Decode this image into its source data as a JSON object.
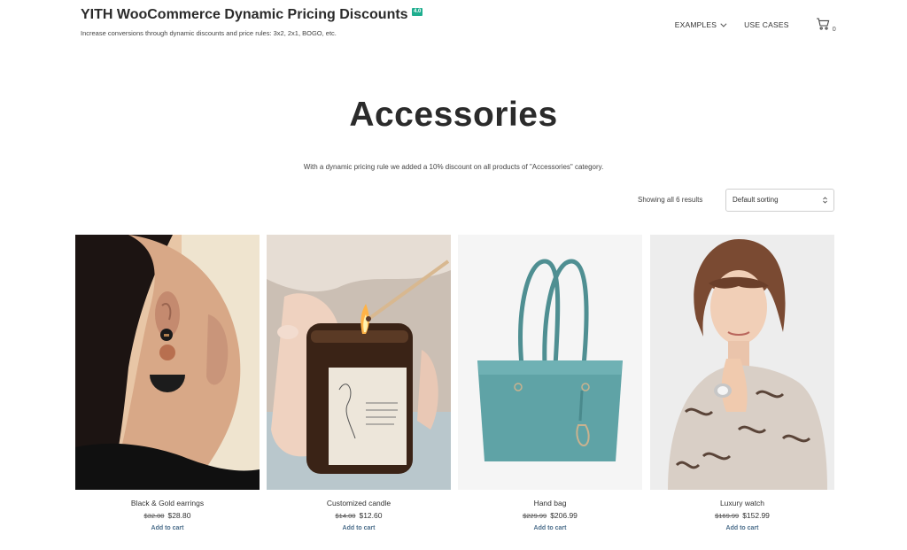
{
  "site": {
    "title": "YITH WooCommerce Dynamic Pricing Discounts",
    "version_badge": "4.0",
    "tagline": "Increase conversions through dynamic discounts and price rules: 3x2, 2x1, BOGO, etc."
  },
  "nav": {
    "items": [
      {
        "label": "EXAMPLES",
        "has_dropdown": true
      },
      {
        "label": "USE CASES",
        "has_dropdown": false
      }
    ],
    "cart_count": "0"
  },
  "page": {
    "title": "Accessories",
    "description": "With a dynamic pricing rule we added a 10% discount on all products of \"Accessories\" category."
  },
  "toolbar": {
    "result_count": "Showing all 6 results",
    "sort_selected": "Default sorting"
  },
  "products": [
    {
      "name": "Black & Gold earrings",
      "old_price": "$32.00",
      "price": "$28.80",
      "cta": "Add to cart"
    },
    {
      "name": "Customized candle",
      "old_price": "$14.00",
      "price": "$12.60",
      "cta": "Add to cart"
    },
    {
      "name": "Hand bag",
      "old_price": "$229.99",
      "price": "$206.99",
      "cta": "Add to cart"
    },
    {
      "name": "Luxury watch",
      "old_price": "$169.99",
      "price": "$152.99",
      "cta": "Add to cart"
    }
  ],
  "colors": {
    "badge": "#1fae8f",
    "link": "#4d6f8c",
    "bag": "#5fa3a6"
  }
}
